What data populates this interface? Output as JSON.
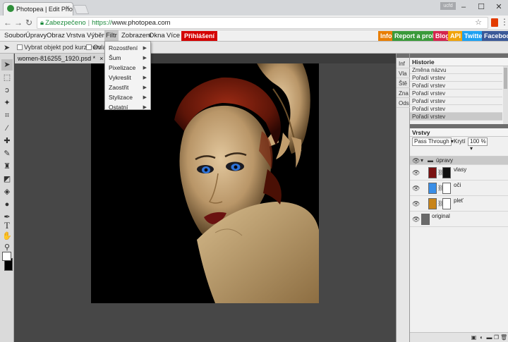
{
  "browser": {
    "tab_title": "Photopea | Edit Photosh",
    "profile_badge": "ucfd",
    "win_min": "–",
    "win_max": "☐",
    "win_close": "✕",
    "secure_label": "Zabezpečeno",
    "url_scheme": "https://",
    "url_host": "www.photopea.com"
  },
  "menubar": {
    "items": [
      "Soubor",
      "Úpravy",
      "Obraz",
      "Vrstva",
      "Výběr",
      "Filtr",
      "Zobrazení",
      "Okna",
      "Více"
    ],
    "login": "Přihlášení",
    "ext": [
      "Info",
      "Report a problem",
      "Blog",
      "API",
      "Twitter",
      "Facebook"
    ],
    "ext_colors": [
      "#e87e04",
      "#3a9a3a",
      "#d4264d",
      "#f0a30a",
      "#1da1f2",
      "#3b5998"
    ]
  },
  "options": {
    "autoselect": "Vybrat objekt pod kurzorem",
    "controls": "Ovlad"
  },
  "document": {
    "tab": "women-816255_1920.psd *",
    "close": "×"
  },
  "filter_menu": {
    "items": [
      "Rozostření",
      "Šum",
      "Pixelizace",
      "Vykreslit",
      "Zaostřit",
      "Stylizace",
      "Ostatní"
    ]
  },
  "mini_panels": [
    "Inf",
    "Vla",
    "Ště",
    "Zna",
    "Ods"
  ],
  "history": {
    "title": "Historie",
    "items": [
      "Změna názvu",
      "Pořadí vrstev",
      "Pořadí vrstev",
      "Pořadí vrstev",
      "Pořadí vrstev",
      "Pořadí vrstev",
      "Pořadí vrstev"
    ]
  },
  "layers": {
    "title": "Vrstvy",
    "blend_mode": "Pass Through",
    "opacity_label": "Krytí",
    "opacity_value": "100 %",
    "group_name": "úpravy",
    "rows": [
      {
        "name": "vlasy",
        "color": "#7a1111"
      },
      {
        "name": "oči",
        "color": "#3a8ee6"
      },
      {
        "name": "pleť",
        "color": "#c8841a"
      }
    ],
    "base_name": "original"
  },
  "colors": {
    "accent_login": "#d40000",
    "canvas_bg": "#474747"
  }
}
